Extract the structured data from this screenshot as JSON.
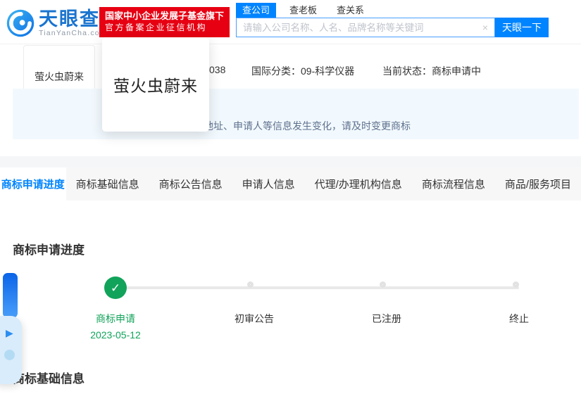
{
  "colors": {
    "brand_blue": "#0084ff",
    "logo_blue": "#1a74cf",
    "badge_red": "#e60012",
    "success_green": "#11a35a",
    "notice_bg": "#f2f9fe",
    "tabbar_bg": "#f7f7f8",
    "progress_line_gray": "#e9e9e9"
  },
  "header": {
    "logo": {
      "brand": "天眼查",
      "domain": "TianYanCha.com"
    },
    "badge": {
      "line1": "国家中小企业发展子基金旗下",
      "line2": "官方备案企业征信机构"
    },
    "search": {
      "tabs": [
        {
          "label": "查公司",
          "active": true
        },
        {
          "label": "查老板",
          "active": false
        },
        {
          "label": "查关系",
          "active": false
        }
      ],
      "placeholder": "请输入公司名称、人名、品牌名称等关键词",
      "clear_icon": "×",
      "button": "天眼一下"
    }
  },
  "summary": {
    "mark_text": "萤火虫蔚来",
    "preview_text": "萤火虫蔚来",
    "reg_no_fragment": "038",
    "intl_class": "国际分类：09-科学仪器",
    "status": "当前状态：商标申请中",
    "notice": "地址、申请人等信息发生变化，请及时变更商标"
  },
  "nav_tabs": [
    {
      "label": "商标申请进度",
      "active": true
    },
    {
      "label": "商标基础信息",
      "active": false
    },
    {
      "label": "商标公告信息",
      "active": false
    },
    {
      "label": "申请人信息",
      "active": false
    },
    {
      "label": "代理/办理机构信息",
      "active": false
    },
    {
      "label": "商标流程信息",
      "active": false
    },
    {
      "label": "商品/服务项目",
      "active": false
    }
  ],
  "progress": {
    "title": "商标申请进度",
    "check_icon": "✓",
    "steps": [
      {
        "label": "商标申请",
        "date": "2023-05-12",
        "state": "done"
      },
      {
        "label": "初审公告",
        "state": "pending"
      },
      {
        "label": "已注册",
        "state": "pending"
      },
      {
        "label": "终止",
        "state": "pending"
      }
    ]
  },
  "basic_info": {
    "title": "商标基础信息"
  }
}
